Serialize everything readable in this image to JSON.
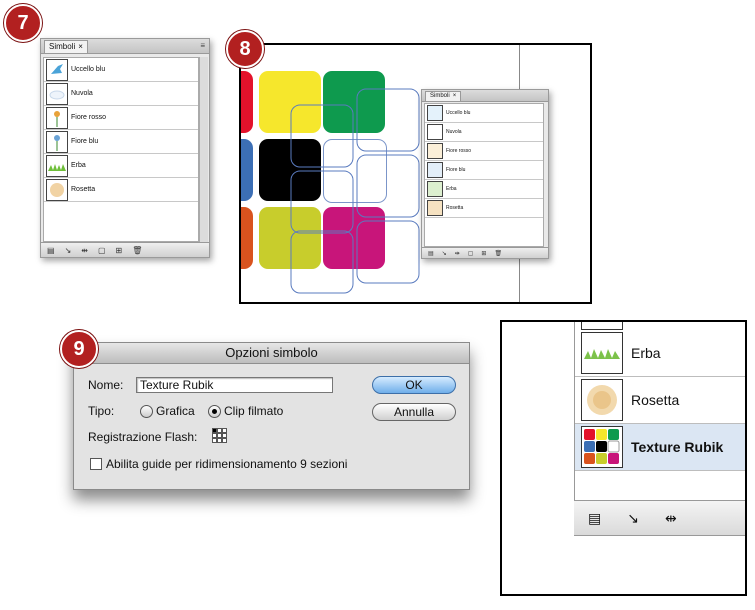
{
  "steps": {
    "seven": "7",
    "eight": "8",
    "nine": "9"
  },
  "symbols_panel": {
    "tab_label": "Simboli",
    "tab_close": "×",
    "menu": "≡",
    "items": [
      {
        "label": "Uccello blu",
        "icon": "bird-icon"
      },
      {
        "label": "Nuvola",
        "icon": "cloud-icon"
      },
      {
        "label": "Fiore rosso",
        "icon": "red-flower-icon"
      },
      {
        "label": "Fiore blu",
        "icon": "blue-flower-icon"
      },
      {
        "label": "Erba",
        "icon": "grass-icon"
      },
      {
        "label": "Rosetta",
        "icon": "rosette-icon"
      }
    ],
    "footer_icons": [
      "library-menu-icon",
      "place-symbol-icon",
      "break-link-icon",
      "symbol-options-icon",
      "new-symbol-icon",
      "delete-symbol-icon"
    ]
  },
  "rubik_colors": [
    "#e3122b",
    "#f6e72c",
    "#0e9a4e",
    "#3c6fb5",
    "#000000",
    "#ffffff",
    "#d9531e",
    "#c8cd2c",
    "#c8157a"
  ],
  "dialog": {
    "title": "Opzioni simbolo",
    "name_label": "Nome:",
    "name_value": "Texture Rubik",
    "type_label": "Tipo:",
    "type_option_graphic": "Grafica",
    "type_option_movieclip": "Clip filmato",
    "selected_type": "Clip filmato",
    "flash_registration_label": "Registrazione Flash:",
    "nine_slice_label": "Abilita guide per ridimensionamento 9 sezioni",
    "ok_label": "OK",
    "cancel_label": "Annulla"
  },
  "zoom_panel": {
    "items": [
      {
        "label": "Erba",
        "icon": "grass-icon"
      },
      {
        "label": "Rosetta",
        "icon": "rosette-icon"
      },
      {
        "label": "Texture Rubik",
        "icon": "rubik-texture-icon",
        "selected": true
      }
    ]
  }
}
